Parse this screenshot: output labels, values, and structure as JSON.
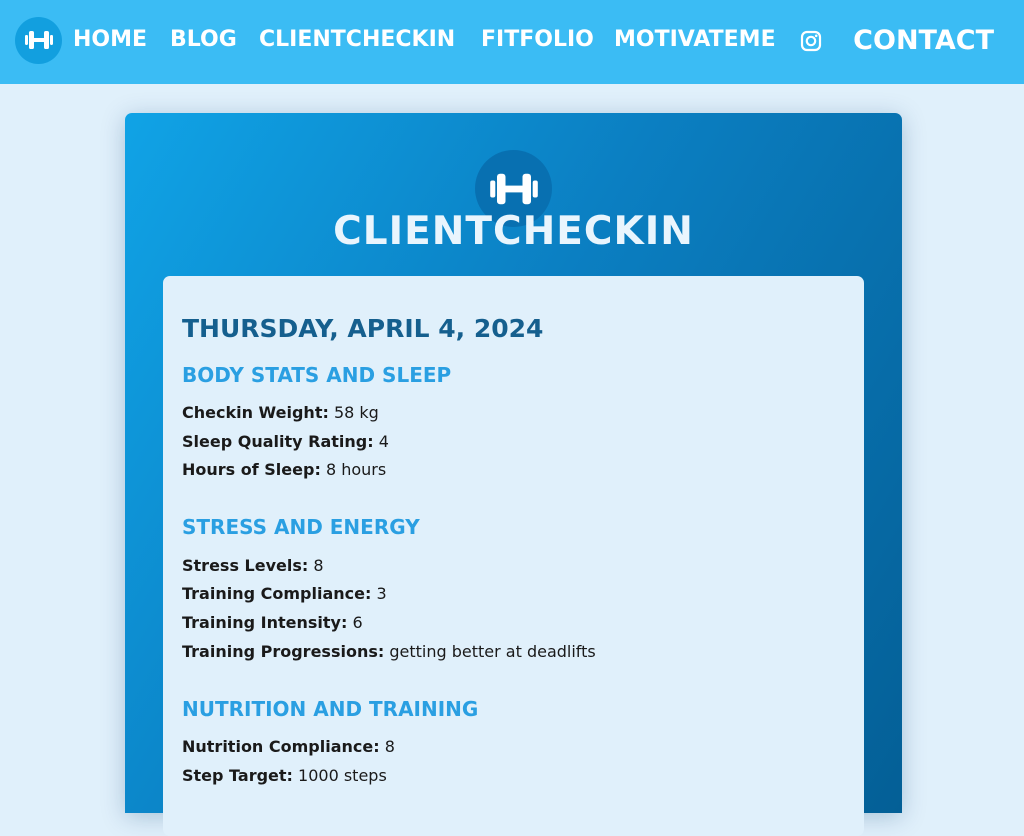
{
  "nav": {
    "logo_icon": "dumbbell-icon",
    "links": [
      "HOME",
      "BLOG",
      "CLIENTCHECKIN",
      "FITFOLIO",
      "MOTIVATEME"
    ],
    "instagram_icon": "instagram-icon",
    "contact": "CONTACT"
  },
  "card": {
    "logo_icon": "dumbbell-icon",
    "title": "CLIENTCHECKIN",
    "date": "THURSDAY, APRIL 4, 2024",
    "sections": [
      {
        "title": "BODY STATS AND SLEEP",
        "rows": [
          {
            "label": "Checkin Weight:",
            "value": "58 kg"
          },
          {
            "label": "Sleep Quality Rating:",
            "value": "4"
          },
          {
            "label": "Hours of Sleep:",
            "value": "8 hours"
          }
        ]
      },
      {
        "title": "STRESS AND ENERGY",
        "rows": [
          {
            "label": "Stress Levels:",
            "value": "8"
          },
          {
            "label": "Training Compliance:",
            "value": "3"
          },
          {
            "label": "Training Intensity:",
            "value": "6"
          },
          {
            "label": "Training Progressions:",
            "value": "getting better at deadlifts"
          }
        ]
      },
      {
        "title": "NUTRITION AND TRAINING",
        "rows": [
          {
            "label": "Nutrition Compliance:",
            "value": "8"
          },
          {
            "label": "Step Target:",
            "value": "1000 steps"
          }
        ]
      }
    ]
  },
  "colors": {
    "nav_bg": "#3bbcf4",
    "page_bg": "#e0f0fb",
    "card_gradient_start": "#10a3e6",
    "card_gradient_end": "#045f96",
    "date_color": "#155f8e",
    "section_title_color": "#2a9fe2"
  }
}
